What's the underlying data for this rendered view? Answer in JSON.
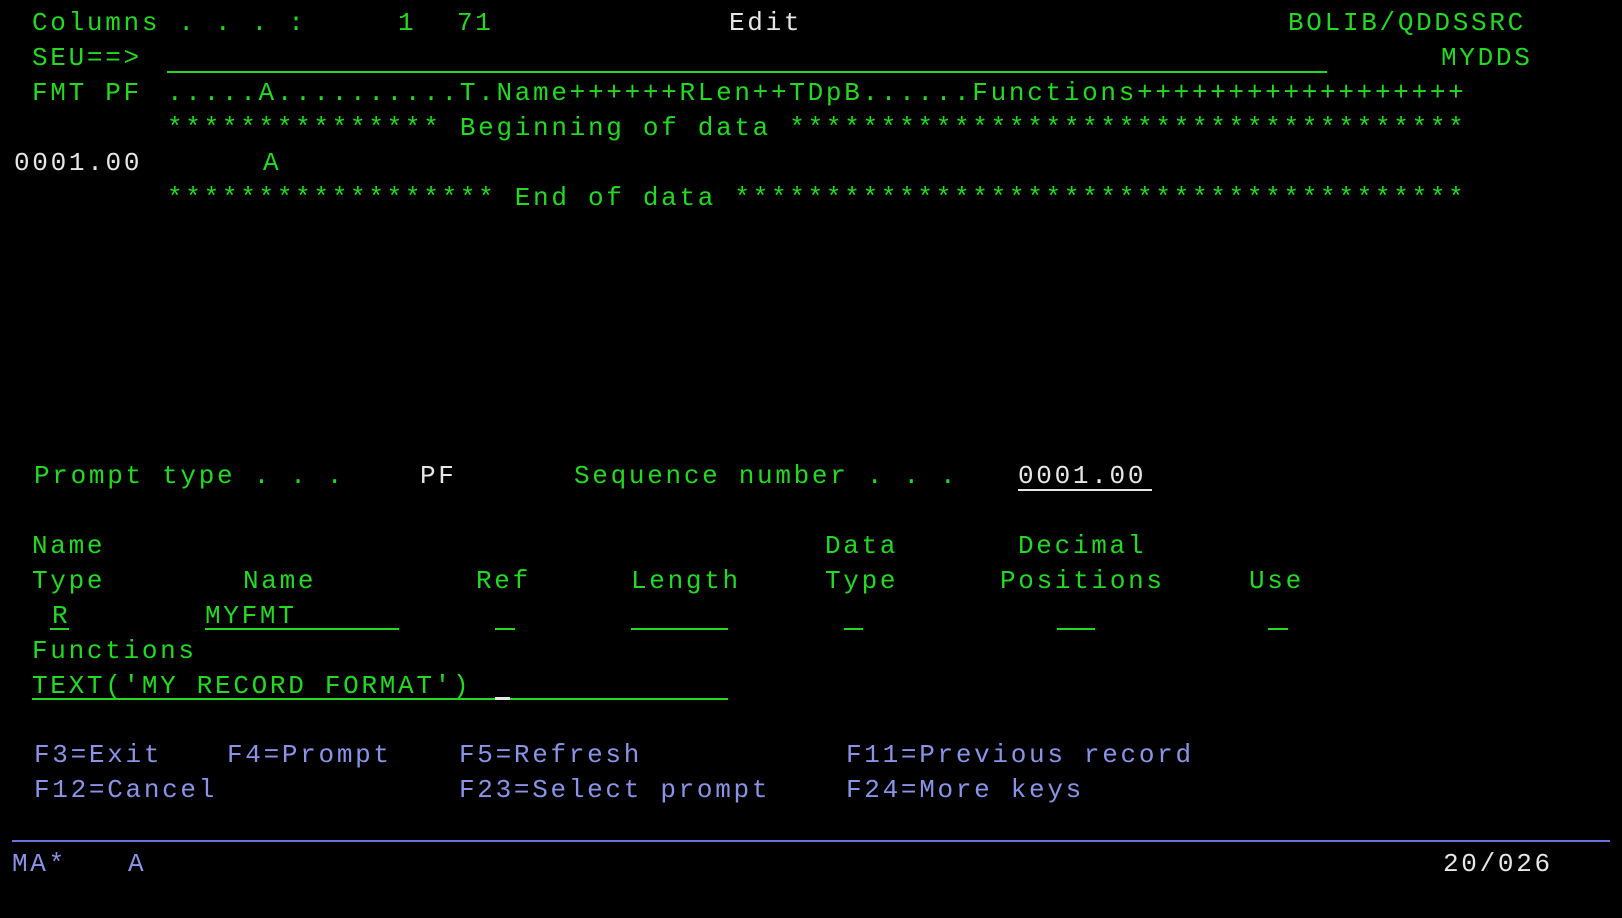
{
  "header": {
    "columns_label": "Columns . . . :",
    "columns_from": "1",
    "columns_to": "71",
    "mode": "Edit",
    "source_file": "BOLIB/QDDSSRC",
    "command_label": "SEU==>",
    "member": "MYDDS",
    "format_label": "FMT PF",
    "format_ruler": ".....A..........T.Name++++++RLen++TDpB......Functions++++++++++++++++++"
  },
  "source": {
    "beginning_marker": "*************** Beginning of data *************************************",
    "lines": [
      {
        "seq": "0001.00",
        "text": "A"
      }
    ],
    "end_marker": "****************** End of data ****************************************"
  },
  "prompt": {
    "prompt_type_label": "Prompt type . . .",
    "prompt_type_value": "PF",
    "sequence_label": "Sequence number . . .",
    "sequence_value": "0001.00",
    "columns": {
      "name_type_line1": "Name",
      "name_type_line2": "Type",
      "name": "Name",
      "ref": "Ref",
      "length": "Length",
      "data_type_line1": "Data",
      "data_type_line2": "Type",
      "decimal_line1": "Decimal",
      "decimal_line2": "Positions",
      "use": "Use"
    },
    "values": {
      "name_type": "R",
      "name": "MYFMT",
      "ref": "",
      "length": "",
      "data_type": "",
      "decimal_positions": "",
      "use": ""
    },
    "functions_label": "Functions",
    "functions_value": "TEXT('MY RECORD FORMAT')"
  },
  "function_keys": {
    "f3": "F3=Exit",
    "f4": "F4=Prompt",
    "f5": "F5=Refresh",
    "f11": "F11=Previous record",
    "f12": "F12=Cancel",
    "f23": "F23=Select prompt",
    "f24": "F24=More keys"
  },
  "status_bar": {
    "session": "MA*",
    "mode": "A",
    "cursor_position": "20/026"
  },
  "colors": {
    "background": "#000000",
    "green": "#23d923",
    "white": "#e6e6e6",
    "blue": "#8a93e6",
    "rule": "#6672e0"
  }
}
